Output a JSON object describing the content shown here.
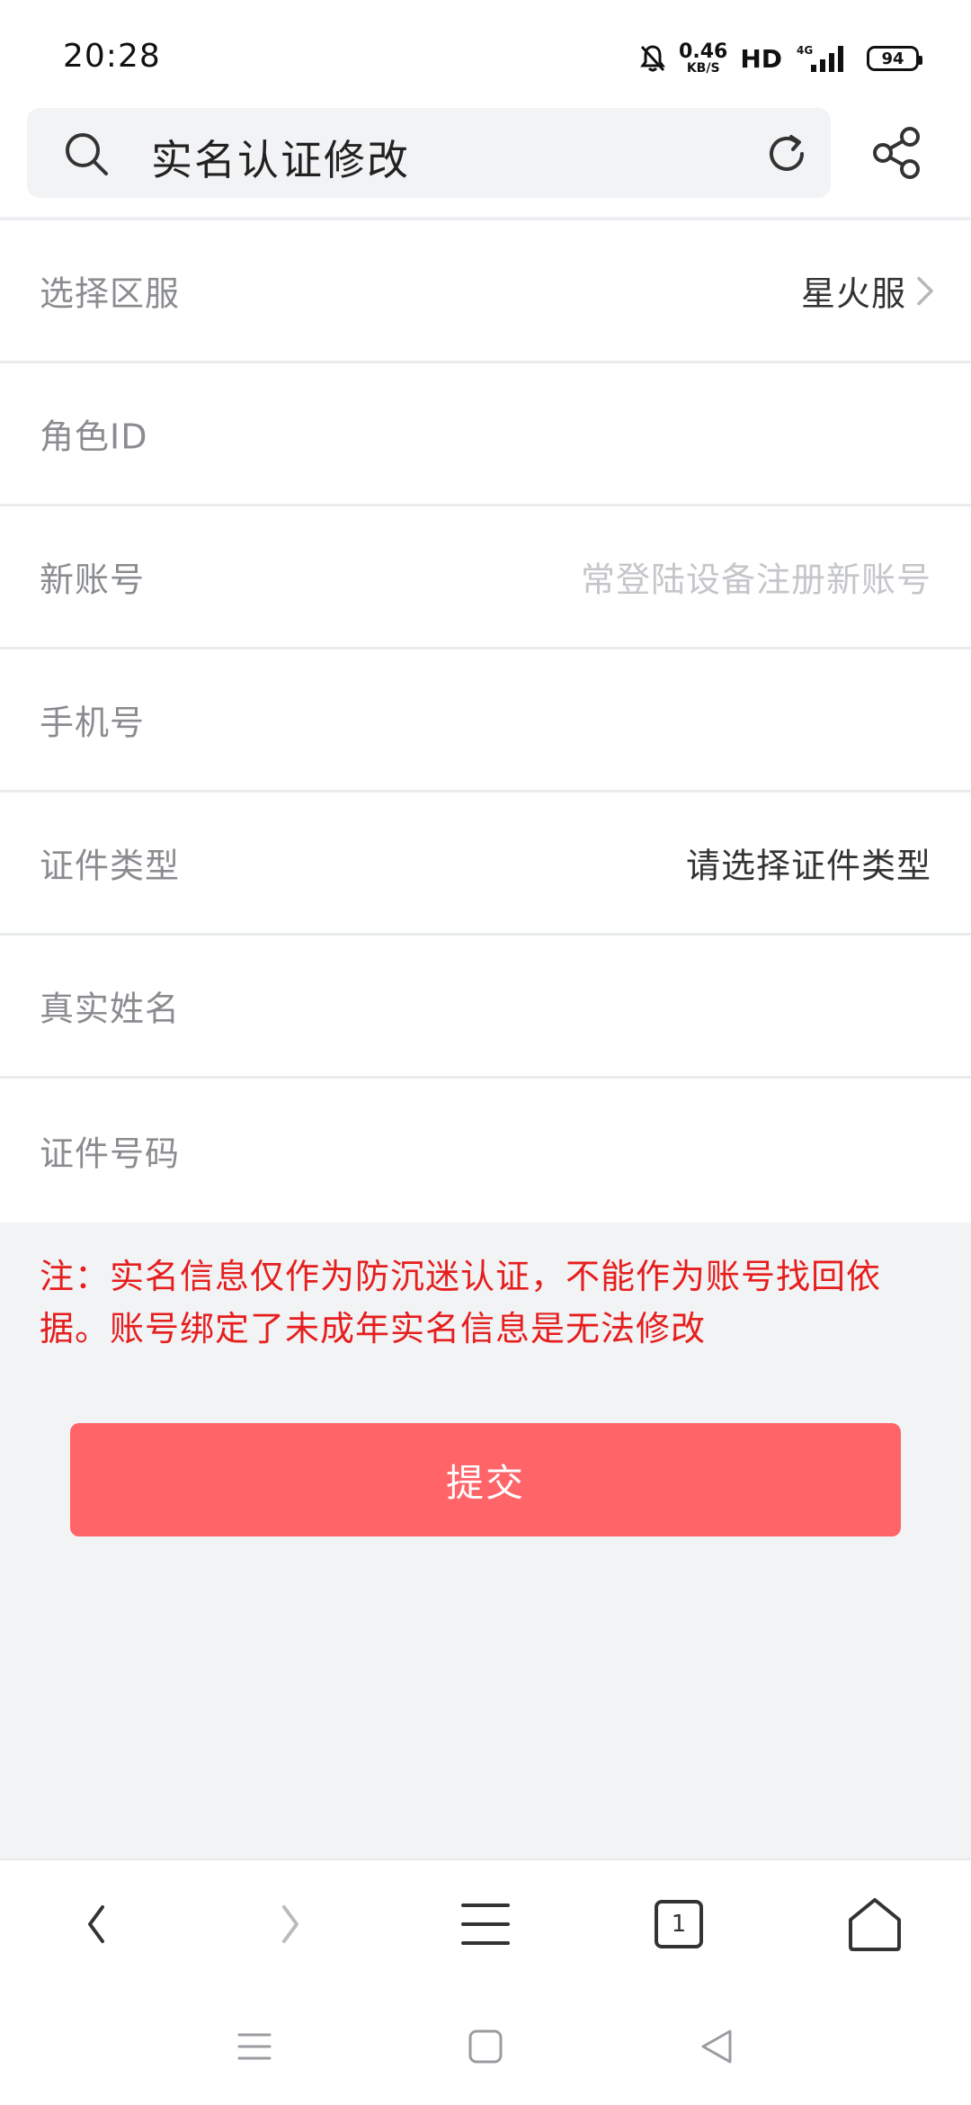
{
  "status_bar": {
    "time": "20:28",
    "net_speed_value": "0.46",
    "net_speed_unit": "KB/S",
    "hd_label": "HD",
    "signal_label": "4G",
    "battery_level": "94",
    "icons": [
      "bell-muted-icon",
      "signal-icon",
      "battery-icon"
    ]
  },
  "header": {
    "search_text": "实名认证修改",
    "icons": [
      "search-icon",
      "refresh-icon",
      "share-icon"
    ]
  },
  "form": {
    "rows": [
      {
        "label": "选择区服",
        "value": "星火服",
        "value_style": "selected",
        "has_arrow": true
      },
      {
        "label": "角色ID",
        "value": "",
        "value_style": "input"
      },
      {
        "label": "新账号",
        "value": "常登陆设备注册新账号",
        "value_style": "placeholder"
      },
      {
        "label": "手机号",
        "value": "",
        "value_style": "input"
      },
      {
        "label": "证件类型",
        "value": "请选择证件类型",
        "value_style": "selected"
      },
      {
        "label": "真实姓名",
        "value": "",
        "value_style": "input"
      },
      {
        "label": "证件号码",
        "value": "",
        "value_style": "input"
      }
    ]
  },
  "note": "注：实名信息仅作为防沉迷认证，不能作为账号找回依据。账号绑定了未成年实名信息是无法修改",
  "submit_label": "提交",
  "browser_bar": {
    "tab_count": "1",
    "icons": [
      "back-arrow-icon",
      "forward-arrow-icon",
      "menu-icon",
      "tabs-icon",
      "home-icon"
    ]
  },
  "system_nav": {
    "icons": [
      "recent-apps-icon",
      "home-square-icon",
      "back-triangle-icon"
    ]
  },
  "colors": {
    "accent": "#ff6469",
    "warning_text": "#e61e1e",
    "background": "#f2f3f5"
  }
}
